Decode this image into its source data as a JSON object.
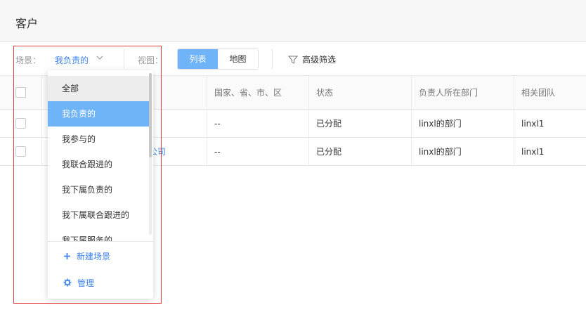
{
  "header": {
    "title": "客户"
  },
  "toolbar": {
    "scene_label": "场景：",
    "scene_value": "我负责的",
    "view_label": "视图：",
    "view_list": "列表",
    "view_map": "地图",
    "filter_label": "高级筛选"
  },
  "table": {
    "columns": [
      "国家、省、市、区",
      "状态",
      "负责人所在部门",
      "相关团队"
    ],
    "rows": [
      {
        "name": "",
        "region": "--",
        "status": "已分配",
        "dept": "linxl的部门",
        "team": "linxl1"
      },
      {
        "name": "公司",
        "region": "--",
        "status": "已分配",
        "dept": "linxl的部门",
        "team": "linxl1"
      }
    ]
  },
  "dropdown": {
    "items": [
      "全部",
      "我负责的",
      "我参与的",
      "我联合跟进的",
      "我下属负责的",
      "我下属联合跟进的",
      "我下属服务的"
    ],
    "new_scene": "新建场景",
    "manage": "管理"
  },
  "colors": {
    "accent": "#3e84e9",
    "selected_bg": "#6fb3f9",
    "frame": "#e23d3d"
  }
}
